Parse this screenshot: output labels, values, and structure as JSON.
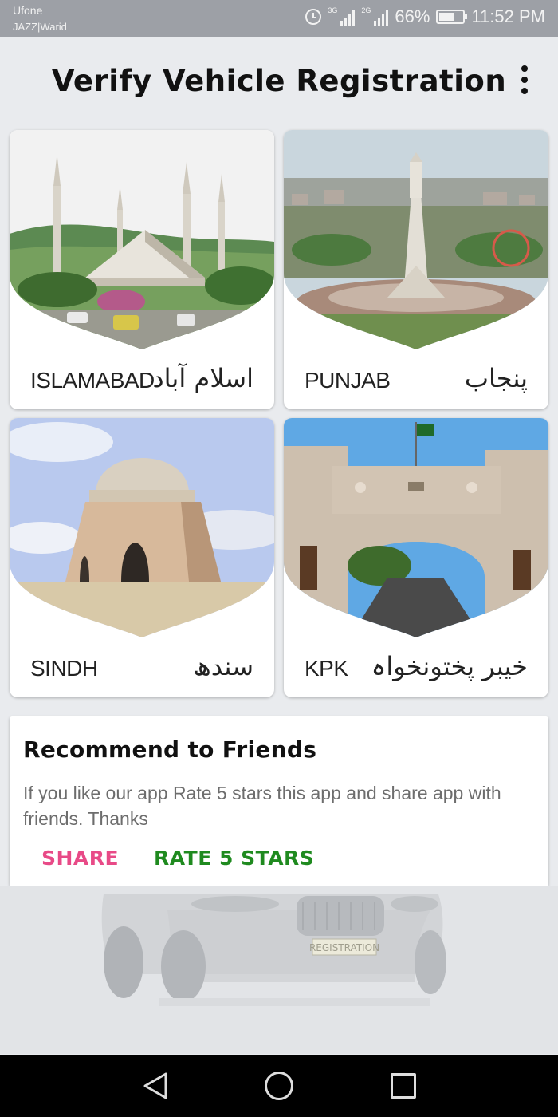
{
  "status_bar": {
    "carrier_1": "Ufone",
    "carrier_2": "JAZZ|Warid",
    "network_1": "3G",
    "network_2": "2G",
    "battery": "66%",
    "battery_level": 0.66,
    "time": "11:52 PM"
  },
  "app_bar": {
    "title": "Verify Vehicle Registration",
    "menu_icon": "more-vertical-icon"
  },
  "regions": [
    {
      "en": "ISLAMABAD",
      "ur": "اسلام آباد",
      "image": "faisal-mosque"
    },
    {
      "en": "PUNJAB",
      "ur": "پنجاب",
      "image": "minar-e-pakistan"
    },
    {
      "en": "SINDH",
      "ur": "سندھ",
      "image": "quaid-mausoleum"
    },
    {
      "en": "KPK",
      "ur": "خیبر پختونخواہ",
      "image": "khyber-gate"
    }
  ],
  "recommend": {
    "title": "Recommend to Friends",
    "body": "If you like our app Rate 5 stars this app and share app with friends. Thanks",
    "share_label": "SHARE",
    "rate_label": "RATE 5 STARS",
    "share_color": "#e84a87",
    "rate_color": "#1f8a1f"
  },
  "background": {
    "plate_text": "REGISTRATION"
  },
  "nav_bar": {
    "back_icon": "back-triangle-icon",
    "home_icon": "home-circle-icon",
    "recent_icon": "recent-square-icon"
  }
}
